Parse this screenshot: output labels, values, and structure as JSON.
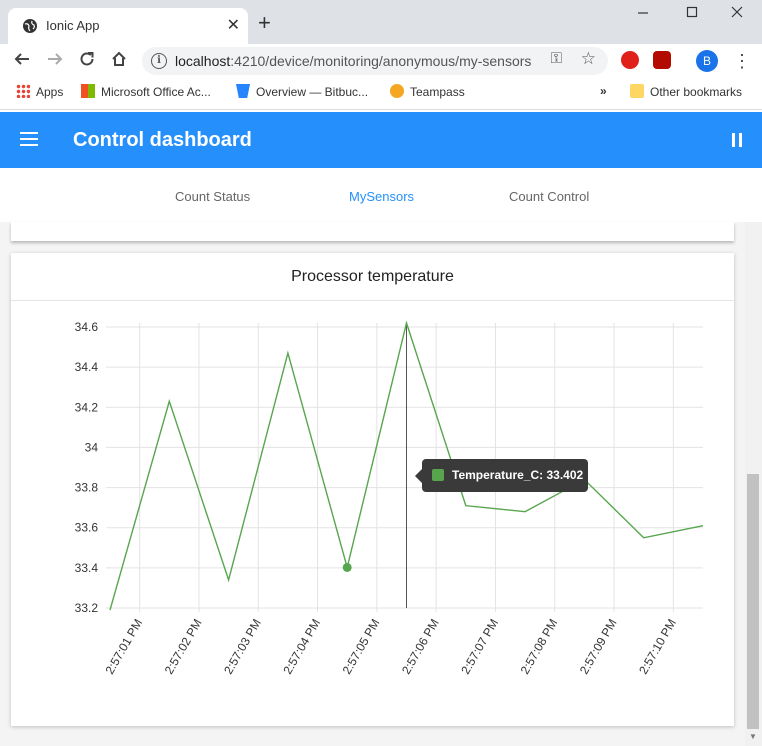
{
  "browser": {
    "tab_title": "Ionic App",
    "tab_close": "✕",
    "new_tab": "+",
    "url_host": "localhost",
    "url_path": ":4210/device/monitoring/anonymous/my-sensors",
    "profile_initial": "B",
    "bookmarks": [
      "Apps",
      "Microsoft Office Ac...",
      "Overview — Bitbuc...",
      "Teampass"
    ],
    "bookmarks_overflow": "»",
    "other_bookmarks": "Other bookmarks"
  },
  "app": {
    "title": "Control dashboard",
    "tabs": [
      "Count Status",
      "MySensors",
      "Count Control"
    ],
    "active_tab": "MySensors"
  },
  "card": {
    "title": "Processor temperature"
  },
  "tooltip": {
    "text": "Temperature_C: 33.402"
  },
  "colors": {
    "header": "#2590fb",
    "line": "#57a64d"
  },
  "chart_data": {
    "type": "line",
    "title": "Processor temperature",
    "series": [
      {
        "name": "Temperature_C",
        "x": [
          "2:57:00.5",
          "2:57:01.5",
          "2:57:02.5",
          "2:57:03.5",
          "2:57:04.5",
          "2:57:05.5",
          "2:57:06.5",
          "2:57:07.5",
          "2:57:08.5",
          "2:57:09.5",
          "2:57:10.5"
        ],
        "values": [
          33.19,
          34.23,
          33.34,
          34.47,
          33.402,
          34.62,
          33.71,
          33.68,
          33.84,
          33.55,
          33.61
        ]
      }
    ],
    "x_tick_labels": [
      "2:57:01 PM",
      "2:57:02 PM",
      "2:57:03 PM",
      "2:57:04 PM",
      "2:57:05 PM",
      "2:57:06 PM",
      "2:57:07 PM",
      "2:57:08 PM",
      "2:57:09 PM",
      "2:57:10 PM"
    ],
    "y_ticks": [
      33.2,
      33.4,
      33.6,
      33.8,
      34,
      34.2,
      34.4,
      34.6
    ],
    "y_tick_labels": [
      "33.2",
      "33.4",
      "33.6",
      "33.8",
      "34",
      "34.2",
      "34.4",
      "34.6"
    ],
    "ylim": [
      33.2,
      34.62
    ],
    "grid": true,
    "highlighted_index": 4
  }
}
